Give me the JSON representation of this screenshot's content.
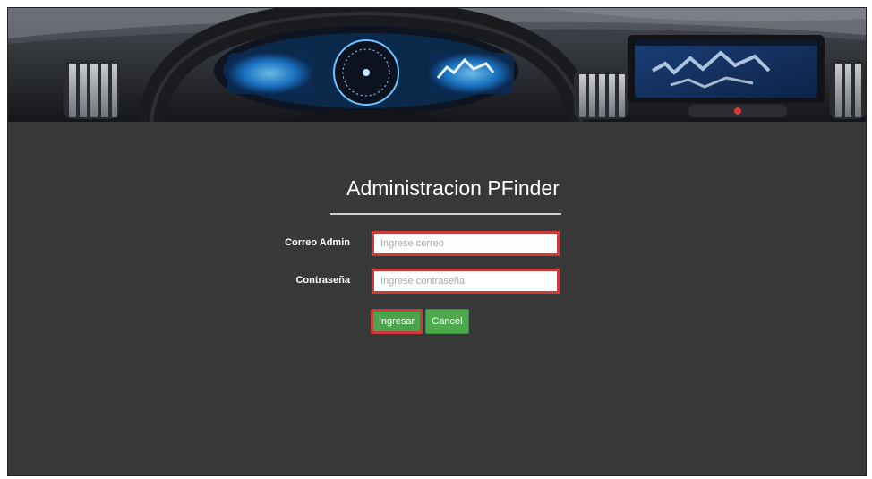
{
  "header": {
    "banner_image": "car-dashboard-banner"
  },
  "login": {
    "title": "Administracion PFinder",
    "email_label": "Correo Admin",
    "email_placeholder": "Ingrese correo",
    "email_value": "",
    "password_label": "Contraseña",
    "password_placeholder": "Ingrese contraseña",
    "password_value": "",
    "submit_label": "Ingresar",
    "cancel_label": "Cancel"
  },
  "colors": {
    "page_background": "#383838",
    "button_green": "#4caa4c",
    "highlight_red": "#d03a3a"
  }
}
